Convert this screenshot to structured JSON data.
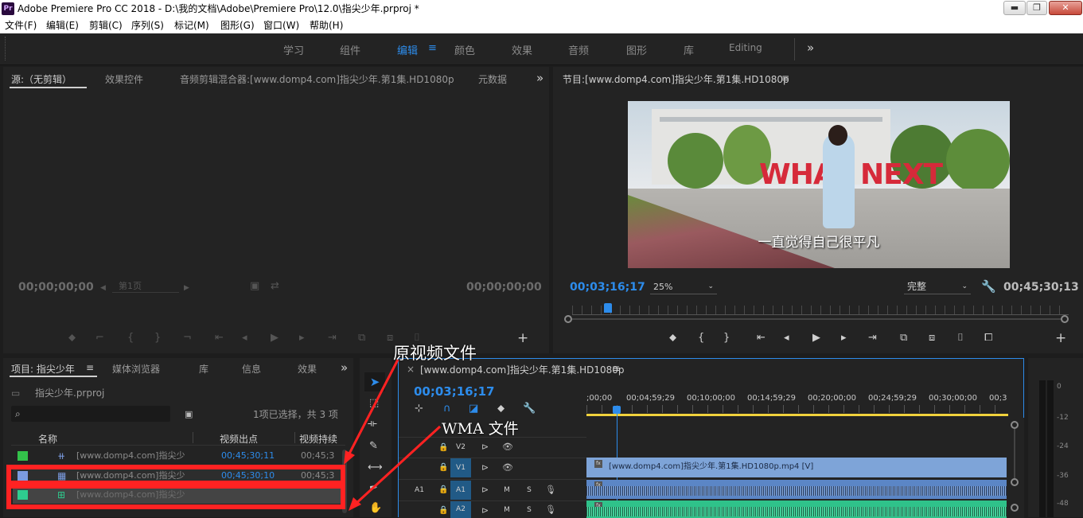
{
  "app": {
    "logo": "Pr",
    "window_title": "Adobe Premiere Pro CC 2018 - D:\\我的文档\\Adobe\\Premiere Pro\\12.0\\指尖少年.prproj *",
    "win_controls": {
      "minimize": "▬",
      "maximize": "❐",
      "close": "✕"
    }
  },
  "menu": [
    "文件(F)",
    "编辑(E)",
    "剪辑(C)",
    "序列(S)",
    "标记(M)",
    "图形(G)",
    "窗口(W)",
    "帮助(H)"
  ],
  "workspaces": {
    "items": [
      "学习",
      "组件",
      "编辑",
      "颜色",
      "效果",
      "音频",
      "图形",
      "库",
      "Editing"
    ],
    "active": "编辑",
    "menu_icon": "≡",
    "overflow": "»"
  },
  "source_panel": {
    "tabs": [
      "源:（无剪辑）",
      "效果控件",
      "音频剪辑混合器:[www.domp4.com]指尖少年.第1集.HD1080p",
      "元数据"
    ],
    "overflow": "»",
    "timecode_in": "00;00;00;00",
    "timecode_out": "00;00;00;00",
    "page_label": "第1页",
    "add": "+"
  },
  "program_panel": {
    "title": "节目:[www.domp4.com]指尖少年.第1集.HD1080p",
    "menu_icon": "≡",
    "subtitle": "一直觉得自己很平凡",
    "scene_text": "WHAT NEXT",
    "timecode": "00;03;16;17",
    "zoom": "25%",
    "quality": "完整",
    "duration": "00;45;30;13",
    "add": "+"
  },
  "project_panel": {
    "tabs": [
      "项目: 指尖少年",
      "媒体浏览器",
      "库",
      "信息",
      "效果"
    ],
    "menu_icon": "≡",
    "overflow": "»",
    "project_file": "指尖少年.prproj",
    "search_placeholder": "",
    "selection_info": "1项已选择，共 3 项",
    "columns": [
      "名称",
      "视频出点",
      "视频持续"
    ],
    "items": [
      {
        "color": "#33c24a",
        "name": "[www.domp4.com]指尖少",
        "out": "00;45;30;11",
        "dur": "00;45;3"
      },
      {
        "color": "#7b9be0",
        "name": "[www.domp4.com]指尖少",
        "out": "00;45;30;10",
        "dur": "00;45;3"
      },
      {
        "color": "#2ecc8f",
        "name": "[www.domp4.com]指尖少",
        "out": "",
        "dur": ""
      }
    ]
  },
  "timeline": {
    "close": "×",
    "title": "[www.domp4.com]指尖少年.第1集.HD1080p",
    "menu_icon": "≡",
    "timecode": "00;03;16;17",
    "ruler": [
      ";00;00",
      "00;04;59;29",
      "00;10;00;00",
      "00;14;59;29",
      "00;20;00;00",
      "00;24;59;29",
      "00;30;00;00",
      "00;3"
    ],
    "tracks": {
      "v2": "V2",
      "v1": "V1",
      "a1_src": "A1",
      "a1": "A1",
      "a2": "A2",
      "m": "M",
      "s": "S"
    },
    "clip_video": "[www.domp4.com]指尖少年.第1集.HD1080p.mp4 [V]",
    "clip_fx": "fx",
    "playhead_fraction": 0.072
  },
  "audio_meter": {
    "labels": [
      "0",
      "-12",
      "-24",
      "-36",
      "-48"
    ]
  },
  "annotations": {
    "original_video": "原视频文件",
    "wma_file": "WMA 文件"
  }
}
